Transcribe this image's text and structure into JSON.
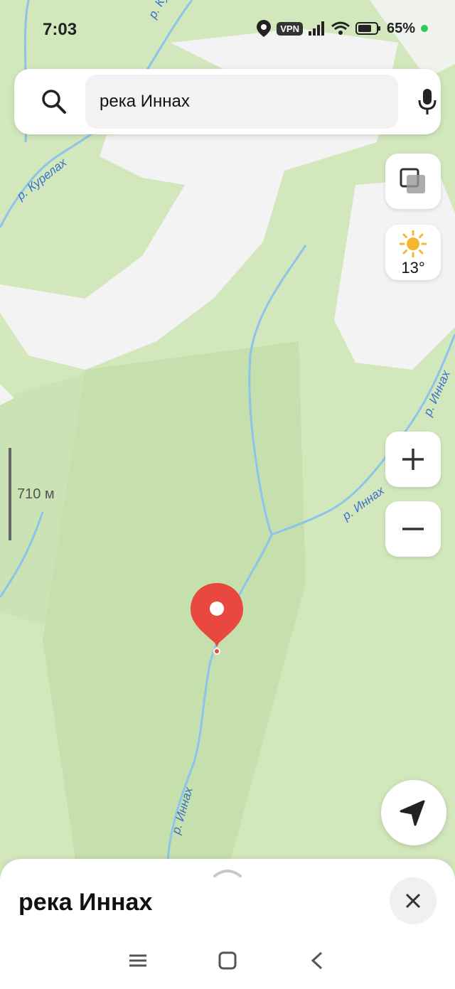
{
  "status_bar": {
    "time": "7:03",
    "vpn_label": "VPN",
    "battery": "65%"
  },
  "search": {
    "query": "река Иннах"
  },
  "weather": {
    "temperature": "13°"
  },
  "scale": {
    "label": "710 м"
  },
  "river_labels": {
    "kurelakh_top": "р. Курелах",
    "kurelakh_left": "р. Курелах",
    "innakh_right_upper": "р. Иннах",
    "innakh_mid": "р. Иннах",
    "innakh_bottom": "р. Иннах"
  },
  "place_card": {
    "title": "река Иннах"
  },
  "colors": {
    "pin_red": "#e8483f",
    "river_blue": "#8cc4ea",
    "map_green": "#d3e7bd",
    "snow": "#f4f4f4"
  },
  "icons": [
    "search-icon",
    "microphone-icon",
    "layers-icon",
    "sun-icon",
    "plus-icon",
    "minus-icon",
    "navigation-arrow-icon",
    "close-icon",
    "chevron-up-icon",
    "menu-icon",
    "home-icon",
    "back-icon"
  ]
}
